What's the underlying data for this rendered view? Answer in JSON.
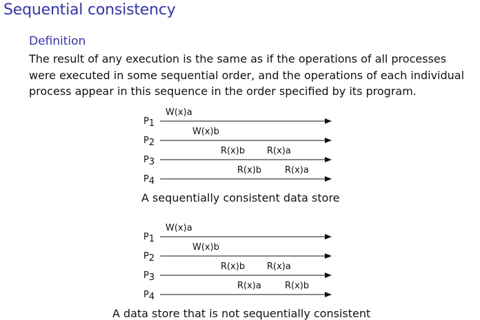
{
  "slide": {
    "title": "Sequential consistency",
    "definition_heading": "Definition",
    "definition_text": "The result of any execution is the same as if the operations of all processes were executed in some sequential order, and the operations of each individual process appear in this sequence in the order specified by its program."
  },
  "colors": {
    "heading": "#3333b2",
    "text": "#111111"
  },
  "diagrams": [
    {
      "caption": "A sequentially consistent data store",
      "processes": [
        {
          "label": "P",
          "sub": "1",
          "ops": [
            "W(x)a"
          ]
        },
        {
          "label": "P",
          "sub": "2",
          "ops": [
            "W(x)b"
          ]
        },
        {
          "label": "P",
          "sub": "3",
          "ops": [
            "R(x)b",
            "R(x)a"
          ]
        },
        {
          "label": "P",
          "sub": "4",
          "ops": [
            "R(x)b",
            "R(x)a"
          ]
        }
      ]
    },
    {
      "caption": "A data store that is not sequentially consistent",
      "processes": [
        {
          "label": "P",
          "sub": "1",
          "ops": [
            "W(x)a"
          ]
        },
        {
          "label": "P",
          "sub": "2",
          "ops": [
            "W(x)b"
          ]
        },
        {
          "label": "P",
          "sub": "3",
          "ops": [
            "R(x)b",
            "R(x)a"
          ]
        },
        {
          "label": "P",
          "sub": "4",
          "ops": [
            "R(x)a",
            "R(x)b"
          ]
        }
      ]
    }
  ]
}
